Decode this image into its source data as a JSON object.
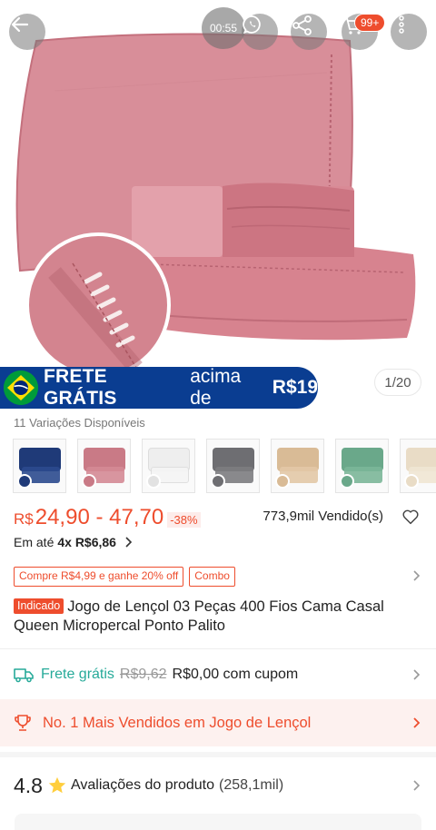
{
  "topbar": {
    "timer": "00:55",
    "cart_badge": "99+",
    "icons": [
      "back-arrow-icon",
      "whatsapp-icon",
      "share-icon",
      "cart-icon",
      "more-vertical-icon"
    ]
  },
  "banner": {
    "strong": "FRETE GRÁTIS",
    "text": "acima de",
    "price": "R$19"
  },
  "image_counter": "1/20",
  "variations": {
    "label": "11 Variações Disponíveis",
    "swatches": [
      "#1f3a78",
      "#c97a86",
      "#eeeeee",
      "#6e6e72",
      "#d9bb96",
      "#6aa88a",
      "#e9dcc6"
    ]
  },
  "price": {
    "currency": "R$",
    "range": "24,90 - 47,70",
    "discount": "-38%",
    "sold": "773,9mil Vendido(s)"
  },
  "installment": {
    "prefix": "Em até",
    "value": "4x R$6,86"
  },
  "promos": [
    "Compre R$4,99 e ganhe 20% off",
    "Combo"
  ],
  "product": {
    "tag": "Indicado",
    "title": "Jogo de Lençol 03 Peças 400 Fios Cama Casal Queen Micropercal Ponto Palito"
  },
  "shipping": {
    "label": "Frete grátis",
    "old_price": "R$9,62",
    "new_price": "R$0,00 com cupom"
  },
  "best_seller": "No. 1 Mais Vendidos em Jogo de Lençol",
  "rating": {
    "score": "4.8",
    "label": "Avaliações do produto",
    "count": "(258,1mil)"
  },
  "colors": {
    "accent": "#ee4d2d",
    "shipping": "#26aa99",
    "banner": "#0a3d91",
    "product_pink": "#cf7f8b"
  }
}
